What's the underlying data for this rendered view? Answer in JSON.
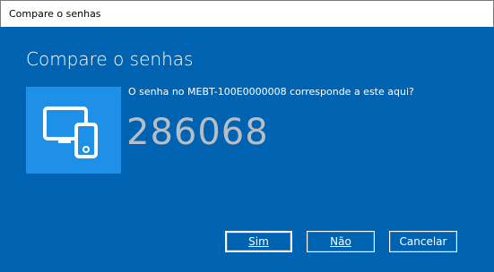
{
  "window": {
    "title": "Compare o senhas"
  },
  "dialog": {
    "heading": "Compare o senhas",
    "question": "O senha no MEBT-100E0000008 corresponde a este aqui?",
    "passcode": "286068",
    "device_icon": "pc-and-phone-icon"
  },
  "buttons": {
    "yes": "Sim",
    "no": "Não",
    "cancel": "Cancelar"
  },
  "colors": {
    "background": "#0063b1",
    "tile": "#1e90e8",
    "passcode": "#b8bec6"
  }
}
